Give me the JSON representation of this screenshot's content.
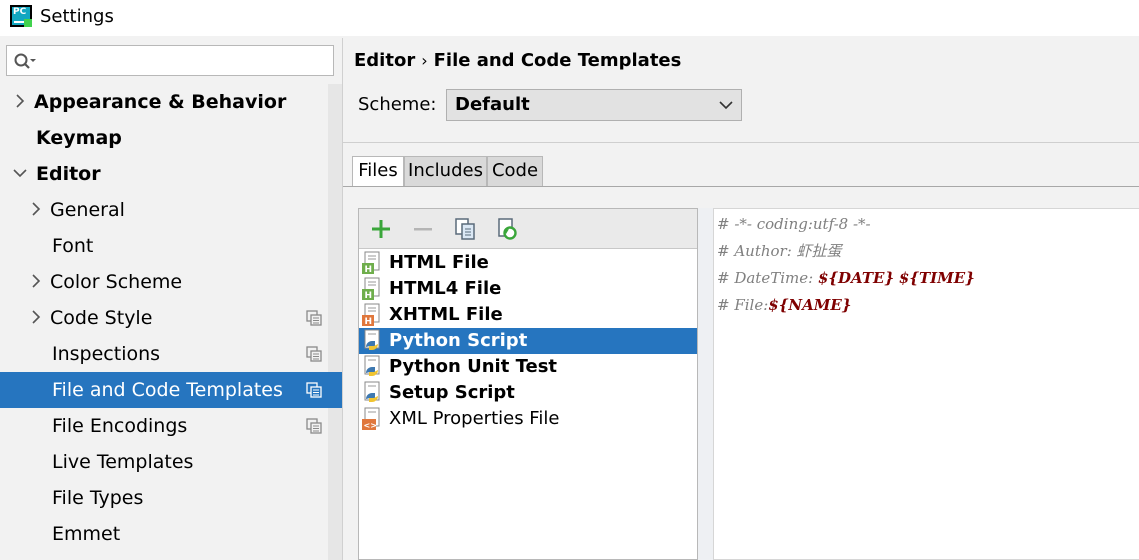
{
  "window": {
    "title": "Settings",
    "app_icon_text": "PC"
  },
  "search": {
    "placeholder": ""
  },
  "sidebar": {
    "items": [
      {
        "label": "Appearance & Behavior",
        "expandable": true,
        "expanded": false
      },
      {
        "label": "Keymap"
      },
      {
        "label": "Editor",
        "expandable": true,
        "expanded": true
      },
      {
        "label": "General",
        "expandable": true,
        "expanded": false
      },
      {
        "label": "Font"
      },
      {
        "label": "Color Scheme",
        "expandable": true,
        "expanded": false
      },
      {
        "label": "Code Style",
        "expandable": true,
        "expanded": false,
        "project_icon": true
      },
      {
        "label": "Inspections",
        "project_icon": true
      },
      {
        "label": "File and Code Templates",
        "selected": true,
        "project_icon": true
      },
      {
        "label": "File Encodings",
        "project_icon": true
      },
      {
        "label": "Live Templates"
      },
      {
        "label": "File Types"
      },
      {
        "label": "Emmet"
      }
    ]
  },
  "breadcrumb": {
    "parent": "Editor",
    "separator": "›",
    "current": "File and Code Templates"
  },
  "scheme": {
    "label": "Scheme:",
    "value": "Default"
  },
  "tabs": [
    {
      "label": "Files",
      "active": true
    },
    {
      "label": "Includes",
      "active": false
    },
    {
      "label": "Code",
      "active": false
    }
  ],
  "toolbar": {
    "buttons": [
      "add-icon",
      "remove-icon",
      "copy-icon",
      "reset-icon"
    ]
  },
  "templates": [
    {
      "label": "HTML File",
      "icon": "html-file-icon",
      "bold": true
    },
    {
      "label": "HTML4 File",
      "icon": "html-file-icon",
      "bold": true
    },
    {
      "label": "XHTML File",
      "icon": "xhtml-file-icon",
      "bold": true
    },
    {
      "label": "Python Script",
      "icon": "python-file-icon",
      "bold": true,
      "selected": true
    },
    {
      "label": "Python Unit Test",
      "icon": "python-file-icon",
      "bold": true
    },
    {
      "label": "Setup Script",
      "icon": "python-file-icon",
      "bold": true
    },
    {
      "label": "XML Properties File",
      "icon": "xml-file-icon",
      "bold": false
    }
  ],
  "editor": {
    "lines": [
      {
        "text": "# -*- coding:utf-8 -*-"
      },
      {
        "text": "# Author: 虾扯蛋"
      },
      {
        "prefix": "# DateTime: ",
        "var1": "${DATE}",
        "mid": " ",
        "var2": "${TIME}"
      },
      {
        "prefix": "# File:",
        "var1": "${NAME}"
      }
    ]
  },
  "colors": {
    "selection": "#2675bf",
    "comment": "#808080",
    "variable": "#7f0000",
    "add": "#3aa63a"
  }
}
